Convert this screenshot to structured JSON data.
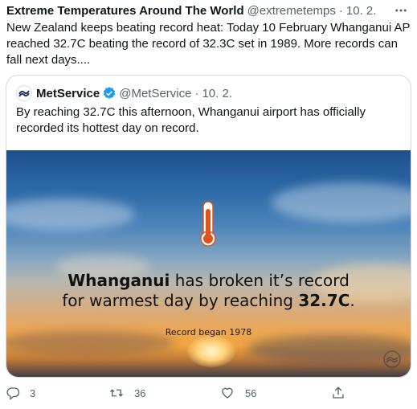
{
  "tweet": {
    "author_name": "Extreme Temperatures Around The World",
    "handle": "@extremetemps",
    "separator": "·",
    "timestamp": "10. 2.",
    "more_icon": "more-icon",
    "text": "New Zealand keeps beating record heat: Today 10 February Whanganui AP reached 32.7C beating the record of 32.3C set in 1989. More records can fall next days...."
  },
  "quote": {
    "name": "MetService",
    "verified": true,
    "handle": "@MetService",
    "separator": "·",
    "timestamp": "10. 2.",
    "text": "By reaching 32.7C this afternoon, Whanganui airport has officially recorded its hottest day on record.",
    "image": {
      "headline_place": "Whanganui",
      "headline_mid": " has broken it’s record",
      "headline_line2": "for warmest day by reaching ",
      "headline_value": "32.7C",
      "headline_end": ".",
      "footnote": "Record began 1978"
    }
  },
  "actions": {
    "reply_count": "3",
    "retweet_count": "36",
    "like_count": "56"
  },
  "colors": {
    "text_primary": "#0f1419",
    "text_secondary": "#536471",
    "verified_blue": "#1d9bf0",
    "border": "#cfd9de",
    "thermometer_red": "#e0531f"
  }
}
